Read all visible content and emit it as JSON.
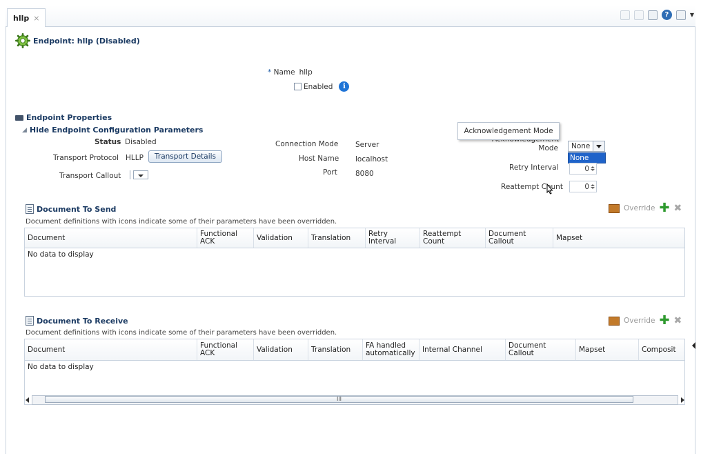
{
  "tab": {
    "label": "hllp",
    "close": "×"
  },
  "toolbar": {
    "help_glyph": "?"
  },
  "header": {
    "title": "Endpoint: hllp (Disabled)"
  },
  "name_field": {
    "required_mark": "*",
    "label": "Name",
    "value": "hllp"
  },
  "enabled": {
    "label": "Enabled",
    "checked": false,
    "info_glyph": "i"
  },
  "properties": {
    "section_title": "Endpoint Properties",
    "toggle_label": "Hide Endpoint Configuration Parameters",
    "status_label": "Status",
    "status_value": "Disabled",
    "protocol_label": "Transport Protocol",
    "protocol_value": "HLLP",
    "transport_details_button": "Transport Details",
    "callout_label": "Transport Callout",
    "connection_mode_label": "Connection Mode",
    "connection_mode_value": "Server",
    "host_name_label": "Host Name",
    "host_name_value": "localhost",
    "port_label": "Port",
    "port_value": "8080",
    "ack_tooltip": "Acknowledgement Mode",
    "ack_label_line1": "Acknowledgement",
    "ack_label_line2": "Mode",
    "ack_selected": "None",
    "ack_options": [
      "None"
    ],
    "retry_interval_label": "Retry Interval",
    "retry_interval_value": "0",
    "reattempt_count_label": "Reattempt Count",
    "reattempt_count_value": "0"
  },
  "send": {
    "title": "Document To Send",
    "description": "Document definitions with icons indicate some of their parameters have been overridden.",
    "override_label": "Override",
    "columns": [
      "Document",
      "Functional ACK",
      "Validation",
      "Translation",
      "Retry Interval",
      "Reattempt Count",
      "Document Callout",
      "Mapset"
    ],
    "empty_text": "No data to display"
  },
  "receive": {
    "title": "Document To Receive",
    "description": "Document definitions with icons indicate some of their parameters have been overridden.",
    "override_label": "Override",
    "columns": [
      "Document",
      "Functional ACK",
      "Validation",
      "Translation",
      "FA handled automatically",
      "Internal Channel",
      "Document Callout",
      "Mapset",
      "Composit"
    ],
    "empty_text": "No data to display",
    "scroll_grip": "III"
  }
}
